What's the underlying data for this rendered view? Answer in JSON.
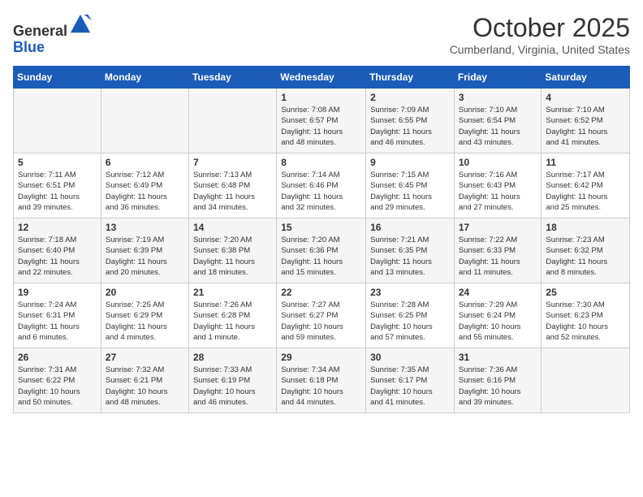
{
  "header": {
    "logo_general": "General",
    "logo_blue": "Blue",
    "month_title": "October 2025",
    "subtitle": "Cumberland, Virginia, United States"
  },
  "calendar": {
    "days_of_week": [
      "Sunday",
      "Monday",
      "Tuesday",
      "Wednesday",
      "Thursday",
      "Friday",
      "Saturday"
    ],
    "weeks": [
      [
        {
          "day": "",
          "info": ""
        },
        {
          "day": "",
          "info": ""
        },
        {
          "day": "",
          "info": ""
        },
        {
          "day": "1",
          "info": "Sunrise: 7:08 AM\nSunset: 6:57 PM\nDaylight: 11 hours\nand 48 minutes."
        },
        {
          "day": "2",
          "info": "Sunrise: 7:09 AM\nSunset: 6:55 PM\nDaylight: 11 hours\nand 46 minutes."
        },
        {
          "day": "3",
          "info": "Sunrise: 7:10 AM\nSunset: 6:54 PM\nDaylight: 11 hours\nand 43 minutes."
        },
        {
          "day": "4",
          "info": "Sunrise: 7:10 AM\nSunset: 6:52 PM\nDaylight: 11 hours\nand 41 minutes."
        }
      ],
      [
        {
          "day": "5",
          "info": "Sunrise: 7:11 AM\nSunset: 6:51 PM\nDaylight: 11 hours\nand 39 minutes."
        },
        {
          "day": "6",
          "info": "Sunrise: 7:12 AM\nSunset: 6:49 PM\nDaylight: 11 hours\nand 36 minutes."
        },
        {
          "day": "7",
          "info": "Sunrise: 7:13 AM\nSunset: 6:48 PM\nDaylight: 11 hours\nand 34 minutes."
        },
        {
          "day": "8",
          "info": "Sunrise: 7:14 AM\nSunset: 6:46 PM\nDaylight: 11 hours\nand 32 minutes."
        },
        {
          "day": "9",
          "info": "Sunrise: 7:15 AM\nSunset: 6:45 PM\nDaylight: 11 hours\nand 29 minutes."
        },
        {
          "day": "10",
          "info": "Sunrise: 7:16 AM\nSunset: 6:43 PM\nDaylight: 11 hours\nand 27 minutes."
        },
        {
          "day": "11",
          "info": "Sunrise: 7:17 AM\nSunset: 6:42 PM\nDaylight: 11 hours\nand 25 minutes."
        }
      ],
      [
        {
          "day": "12",
          "info": "Sunrise: 7:18 AM\nSunset: 6:40 PM\nDaylight: 11 hours\nand 22 minutes."
        },
        {
          "day": "13",
          "info": "Sunrise: 7:19 AM\nSunset: 6:39 PM\nDaylight: 11 hours\nand 20 minutes."
        },
        {
          "day": "14",
          "info": "Sunrise: 7:20 AM\nSunset: 6:38 PM\nDaylight: 11 hours\nand 18 minutes."
        },
        {
          "day": "15",
          "info": "Sunrise: 7:20 AM\nSunset: 6:36 PM\nDaylight: 11 hours\nand 15 minutes."
        },
        {
          "day": "16",
          "info": "Sunrise: 7:21 AM\nSunset: 6:35 PM\nDaylight: 11 hours\nand 13 minutes."
        },
        {
          "day": "17",
          "info": "Sunrise: 7:22 AM\nSunset: 6:33 PM\nDaylight: 11 hours\nand 11 minutes."
        },
        {
          "day": "18",
          "info": "Sunrise: 7:23 AM\nSunset: 6:32 PM\nDaylight: 11 hours\nand 8 minutes."
        }
      ],
      [
        {
          "day": "19",
          "info": "Sunrise: 7:24 AM\nSunset: 6:31 PM\nDaylight: 11 hours\nand 6 minutes."
        },
        {
          "day": "20",
          "info": "Sunrise: 7:25 AM\nSunset: 6:29 PM\nDaylight: 11 hours\nand 4 minutes."
        },
        {
          "day": "21",
          "info": "Sunrise: 7:26 AM\nSunset: 6:28 PM\nDaylight: 11 hours\nand 1 minute."
        },
        {
          "day": "22",
          "info": "Sunrise: 7:27 AM\nSunset: 6:27 PM\nDaylight: 10 hours\nand 59 minutes."
        },
        {
          "day": "23",
          "info": "Sunrise: 7:28 AM\nSunset: 6:25 PM\nDaylight: 10 hours\nand 57 minutes."
        },
        {
          "day": "24",
          "info": "Sunrise: 7:29 AM\nSunset: 6:24 PM\nDaylight: 10 hours\nand 55 minutes."
        },
        {
          "day": "25",
          "info": "Sunrise: 7:30 AM\nSunset: 6:23 PM\nDaylight: 10 hours\nand 52 minutes."
        }
      ],
      [
        {
          "day": "26",
          "info": "Sunrise: 7:31 AM\nSunset: 6:22 PM\nDaylight: 10 hours\nand 50 minutes."
        },
        {
          "day": "27",
          "info": "Sunrise: 7:32 AM\nSunset: 6:21 PM\nDaylight: 10 hours\nand 48 minutes."
        },
        {
          "day": "28",
          "info": "Sunrise: 7:33 AM\nSunset: 6:19 PM\nDaylight: 10 hours\nand 46 minutes."
        },
        {
          "day": "29",
          "info": "Sunrise: 7:34 AM\nSunset: 6:18 PM\nDaylight: 10 hours\nand 44 minutes."
        },
        {
          "day": "30",
          "info": "Sunrise: 7:35 AM\nSunset: 6:17 PM\nDaylight: 10 hours\nand 41 minutes."
        },
        {
          "day": "31",
          "info": "Sunrise: 7:36 AM\nSunset: 6:16 PM\nDaylight: 10 hours\nand 39 minutes."
        },
        {
          "day": "",
          "info": ""
        }
      ]
    ]
  }
}
